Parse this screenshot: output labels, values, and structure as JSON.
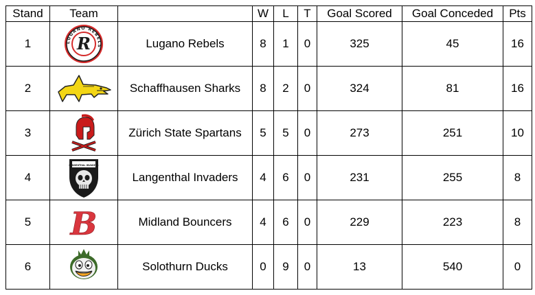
{
  "table": {
    "headers": {
      "stand": "Stand",
      "team": "Team",
      "name": "",
      "w": "W",
      "l": "L",
      "t": "T",
      "goal_scored": "Goal Scored",
      "goal_conceded": "Goal Conceded",
      "pts": "Pts"
    },
    "rows": [
      {
        "stand": "1",
        "logo": "lugano-rebels-logo",
        "name": "Lugano Rebels",
        "w": "8",
        "l": "1",
        "t": "0",
        "goal_scored": "325",
        "goal_conceded": "45",
        "pts": "16"
      },
      {
        "stand": "2",
        "logo": "shark-logo",
        "name": "Schaffhausen Sharks",
        "w": "8",
        "l": "2",
        "t": "0",
        "goal_scored": "324",
        "goal_conceded": "81",
        "pts": "16"
      },
      {
        "stand": "3",
        "logo": "spartan-helmet-logo",
        "name": "Zürich State Spartans",
        "w": "5",
        "l": "5",
        "t": "0",
        "goal_scored": "273",
        "goal_conceded": "251",
        "pts": "10"
      },
      {
        "stand": "4",
        "logo": "invaders-skull-logo",
        "name": "Langenthal Invaders",
        "w": "4",
        "l": "6",
        "t": "0",
        "goal_scored": "231",
        "goal_conceded": "255",
        "pts": "8"
      },
      {
        "stand": "5",
        "logo": "bouncers-b-logo",
        "name": "Midland Bouncers",
        "w": "4",
        "l": "6",
        "t": "0",
        "goal_scored": "229",
        "goal_conceded": "223",
        "pts": "8"
      },
      {
        "stand": "6",
        "logo": "duck-logo",
        "name": "Solothurn Ducks",
        "w": "0",
        "l": "9",
        "t": "0",
        "goal_scored": "13",
        "goal_conceded": "540",
        "pts": "0"
      }
    ]
  },
  "logos": {
    "lugano": {
      "ring_text": "LUGANO REBELS",
      "letter": "R"
    },
    "invaders": {
      "banner_text": "LANGENTHAL INVADERS"
    },
    "bouncers": {
      "letter": "B"
    }
  },
  "colors": {
    "rebels_red": "#d42a2a",
    "shark_yellow": "#f3d615",
    "spartan_red": "#c91b1b",
    "bouncers_red": "#d9363e",
    "duck_green": "#3d6b2a",
    "duck_orange": "#f5a623"
  }
}
